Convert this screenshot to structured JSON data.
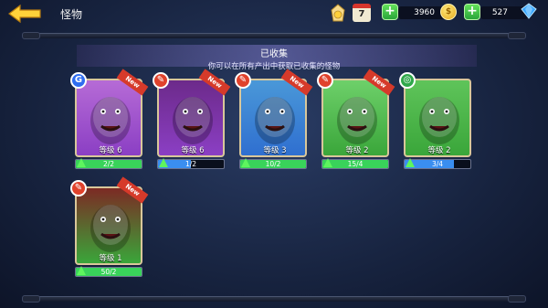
{
  "header": {
    "title": "怪物",
    "calendar_day": "7",
    "gold": "3960",
    "gems": "527"
  },
  "panel": {
    "title": "已收集",
    "description": "你可以在所有产出中获取已收集的怪物"
  },
  "cards": [
    {
      "level": "等级 6",
      "progress": "2/2",
      "progress_value": 1.0,
      "bar_color": "#39d35a",
      "frame": "#8b3fc4",
      "bg": "#b66bd6",
      "badge": "G",
      "badge_color": "#2f6df0",
      "new_label": "New",
      "show_new": true
    },
    {
      "level": "等级 6",
      "progress": "1/2",
      "progress_value": 0.5,
      "bar_color": "#3a8ef0",
      "frame": "#8b3fc4",
      "bg": "#6c2a8a",
      "badge": "✎",
      "badge_color": "#e0422c",
      "new_label": "New",
      "show_new": true
    },
    {
      "level": "等级 3",
      "progress": "10/2",
      "progress_value": 1.0,
      "bar_color": "#39d35a",
      "frame": "#2f6fd0",
      "bg": "#4a98d8",
      "badge": "✎",
      "badge_color": "#e0422c",
      "new_label": "New",
      "show_new": true
    },
    {
      "level": "等级 2",
      "progress": "15/4",
      "progress_value": 1.0,
      "bar_color": "#39d35a",
      "frame": "#3aa63a",
      "bg": "#6ed06a",
      "badge": "✎",
      "badge_color": "#e0422c",
      "new_label": "New",
      "show_new": true
    },
    {
      "level": "等级 2",
      "progress": "3/4",
      "progress_value": 0.75,
      "bar_color": "#3a8ef0",
      "frame": "#3aa63a",
      "bg": "#5fc45a",
      "badge": "◎",
      "badge_color": "#2fa84a",
      "new_label": "New",
      "show_new": false
    },
    {
      "level": "等级 1",
      "progress": "50/2",
      "progress_value": 1.0,
      "bar_color": "#39d35a",
      "frame": "#3aa63a",
      "bg": "#7c2a24",
      "badge": "✎",
      "badge_color": "#e0422c",
      "new_label": "New",
      "show_new": true
    }
  ]
}
